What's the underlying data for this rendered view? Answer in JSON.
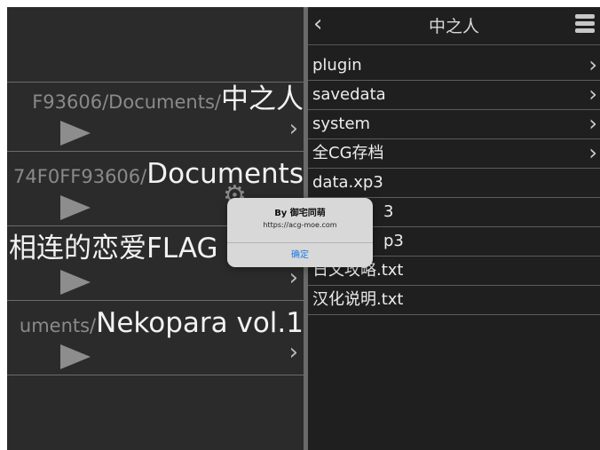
{
  "left_pane": {
    "history": [
      {
        "prefix": "F93606/Documents/",
        "name": "中之人"
      },
      {
        "prefix": "74F0FF93606/",
        "name": "Documents"
      },
      {
        "prefix": "",
        "name": "相连的恋爱FLAG"
      },
      {
        "prefix": "uments/",
        "name": "Nekopara vol.1"
      }
    ]
  },
  "right_pane": {
    "title": "中之人",
    "back_icon": "chevron-left-icon",
    "menu_icon": "menu-icon",
    "files": [
      {
        "name": "plugin",
        "chevron": "›"
      },
      {
        "name": "savedata",
        "chevron": "›"
      },
      {
        "name": "system",
        "chevron": "›"
      },
      {
        "name": "全CG存档",
        "chevron": "›"
      },
      {
        "name": "data.xp3",
        "chevron": ""
      },
      {
        "name": "3",
        "chevron": ""
      },
      {
        "name": "p3",
        "chevron": ""
      },
      {
        "name": "日文攻略.txt",
        "chevron": ""
      },
      {
        "name": "汉化说明.txt",
        "chevron": ""
      }
    ]
  },
  "alert": {
    "title": "By 御宅同萌",
    "message": "https://acg-moe.com",
    "ok_label": "确定"
  },
  "glyphs": {
    "chevron_right": "›",
    "chevron_left": "‹",
    "gear": "⚙"
  }
}
